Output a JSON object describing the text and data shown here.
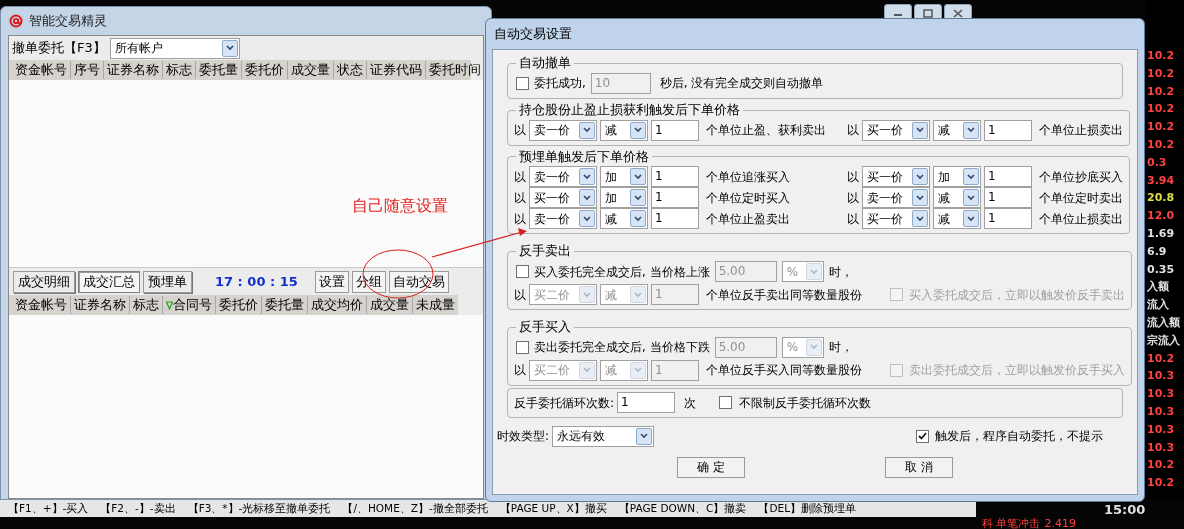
{
  "main_window": {
    "title": "智能交易精灵",
    "cancel_label": "撤单委托【F3】",
    "account_select": "所有帐户",
    "order_columns": [
      "资金帐号",
      "序号",
      "证券名称",
      "标志",
      "委托量",
      "委托价",
      "成交量",
      "状态",
      "证券代码",
      "委托时间"
    ],
    "tabs": [
      {
        "label": "成交明细",
        "selected": false
      },
      {
        "label": "成交汇总",
        "selected": true
      },
      {
        "label": "预埋单",
        "selected": false
      }
    ],
    "clock": "17 : 00 : 15",
    "buttons": [
      "设置",
      "分组",
      "自动交易"
    ],
    "trade_columns": [
      {
        "label": "资金帐号",
        "sorted": false
      },
      {
        "label": "证券名称",
        "sorted": false
      },
      {
        "label": "标志",
        "sorted": false
      },
      {
        "label": "合同号",
        "sorted": true
      },
      {
        "label": "委托价",
        "sorted": false
      },
      {
        "label": "委托量",
        "sorted": false
      },
      {
        "label": "成交均价",
        "sorted": false
      },
      {
        "label": "成交量",
        "sorted": false
      },
      {
        "label": "未成量",
        "sorted": false
      }
    ]
  },
  "annotation": {
    "text": "自己随意设置"
  },
  "shortcut_bar": [
    "【F1、+】-买入",
    "【F2、-】-卖出",
    "【F3、*】-光标移至撤单委托",
    "【/、HOME、Z】-撤全部委托",
    "【PAGE UP、X】撤买",
    "【PAGE DOWN、C】撤卖",
    "【DEL】删除预埋单"
  ],
  "dialog": {
    "title": "自动交易设置",
    "auto_cancel": {
      "legend": "自动撤单",
      "checked": false,
      "label": "委托成功,",
      "seconds": "10",
      "suffix": "秒后, 没有完全成交则自动撤单"
    },
    "position_prices": {
      "legend": "持仓股份止盈止损获利触发后下单价格",
      "rows": [
        [
          {
            "prefix": "以",
            "price": "卖一价",
            "op": "减",
            "units": "1",
            "suffix": "个单位止盈、获利卖出",
            "disabled": false
          },
          {
            "prefix": "以",
            "price": "买一价",
            "op": "减",
            "units": "1",
            "suffix": "个单位止损卖出",
            "disabled": false
          }
        ]
      ]
    },
    "pending_prices": {
      "legend": "预埋单触发后下单价格",
      "rows": [
        [
          {
            "prefix": "以",
            "price": "卖一价",
            "op": "加",
            "units": "1",
            "suffix": "个单位追涨买入",
            "disabled": false
          },
          {
            "prefix": "以",
            "price": "买一价",
            "op": "加",
            "units": "1",
            "suffix": "个单位抄底买入",
            "disabled": false
          }
        ],
        [
          {
            "prefix": "以",
            "price": "买一价",
            "op": "加",
            "units": "1",
            "suffix": "个单位定时买入",
            "disabled": false
          },
          {
            "prefix": "以",
            "price": "卖一价",
            "op": "减",
            "units": "1",
            "suffix": "个单位定时卖出",
            "disabled": false
          }
        ],
        [
          {
            "prefix": "以",
            "price": "卖一价",
            "op": "减",
            "units": "1",
            "suffix": "个单位止盈卖出",
            "disabled": false
          },
          {
            "prefix": "以",
            "price": "买一价",
            "op": "减",
            "units": "1",
            "suffix": "个单位止损卖出",
            "disabled": false
          }
        ]
      ]
    },
    "reverse": [
      {
        "legend": "反手卖出",
        "checked": false,
        "label": "买入委托完全成交后, 当价格上涨",
        "percent": "5.00",
        "unit": "%",
        "unit_disabled": true,
        "after": "时，",
        "order": {
          "prefix": "以",
          "price": "买二价",
          "op": "减",
          "units": "1",
          "suffix": "个单位反手卖出同等数量股份",
          "disabled": true
        },
        "instant": {
          "checked": false,
          "disabled": true,
          "label": "买入委托成交后，立即以触发价反手卖出"
        }
      },
      {
        "legend": "反手买入",
        "checked": false,
        "label": "卖出委托完全成交后, 当价格下跌",
        "percent": "5.00",
        "unit": "%",
        "unit_disabled": true,
        "after": "时，",
        "order": {
          "prefix": "以",
          "price": "买二价",
          "op": "减",
          "units": "1",
          "suffix": "个单位反手买入同等数量股份",
          "disabled": true
        },
        "instant": {
          "checked": false,
          "disabled": true,
          "label": "卖出委托成交后，立即以触发价反手买入"
        }
      }
    ],
    "loop": {
      "label": "反手委托循环次数:",
      "count": "1",
      "unit": "次",
      "unlimited_checked": false,
      "unlimited_label": "不限制反手委托循环次数"
    },
    "validity": {
      "label": "时效类型:",
      "value": "永远有效"
    },
    "auto_confirm": {
      "checked": true,
      "label": "触发后，程序自动委托，不提示"
    },
    "buttons": [
      "确 定",
      "取 消"
    ]
  },
  "side_panel": {
    "values": [
      {
        "text": "10.2",
        "color": "#ff4040"
      },
      {
        "text": "10.2",
        "color": "#ff4040"
      },
      {
        "text": "10.2",
        "color": "#ff4040"
      },
      {
        "text": "10.2",
        "color": "#ff4040"
      },
      {
        "text": "10.2",
        "color": "#ff4040"
      },
      {
        "text": "10.2",
        "color": "#ff4040"
      },
      {
        "text": "0.3",
        "color": "#ff4040"
      },
      {
        "text": "3.94",
        "color": "#ff4040"
      },
      {
        "text": "20.8",
        "color": "#e0e040"
      },
      {
        "text": "12.0",
        "color": "#ff4040"
      },
      {
        "text": "1.69",
        "color": "#e0e0e0"
      },
      {
        "text": "6.9",
        "color": "#e0e0e0"
      },
      {
        "text": "0.35",
        "color": "#e0e0e0"
      },
      {
        "text": "入额",
        "color": "#e0e0e0"
      },
      {
        "text": "流入",
        "color": "#e0e0e0"
      },
      {
        "text": "流入额",
        "color": "#e0e0e0"
      },
      {
        "text": "宗流入",
        "color": "#e0e0e0"
      },
      {
        "text": "10.2",
        "color": "#ff4040"
      },
      {
        "text": "10.3",
        "color": "#ff4040"
      },
      {
        "text": "10.3",
        "color": "#ff4040"
      },
      {
        "text": "10.3",
        "color": "#ff4040"
      },
      {
        "text": "10.3",
        "color": "#ff4040"
      },
      {
        "text": "10.3",
        "color": "#ff4040"
      },
      {
        "text": "10.2",
        "color": "#ff4040"
      },
      {
        "text": "10.2",
        "color": "#ff4040"
      }
    ],
    "time": "15:00",
    "impact_label": "科 单笔冲击",
    "impact_value": "2.419"
  }
}
